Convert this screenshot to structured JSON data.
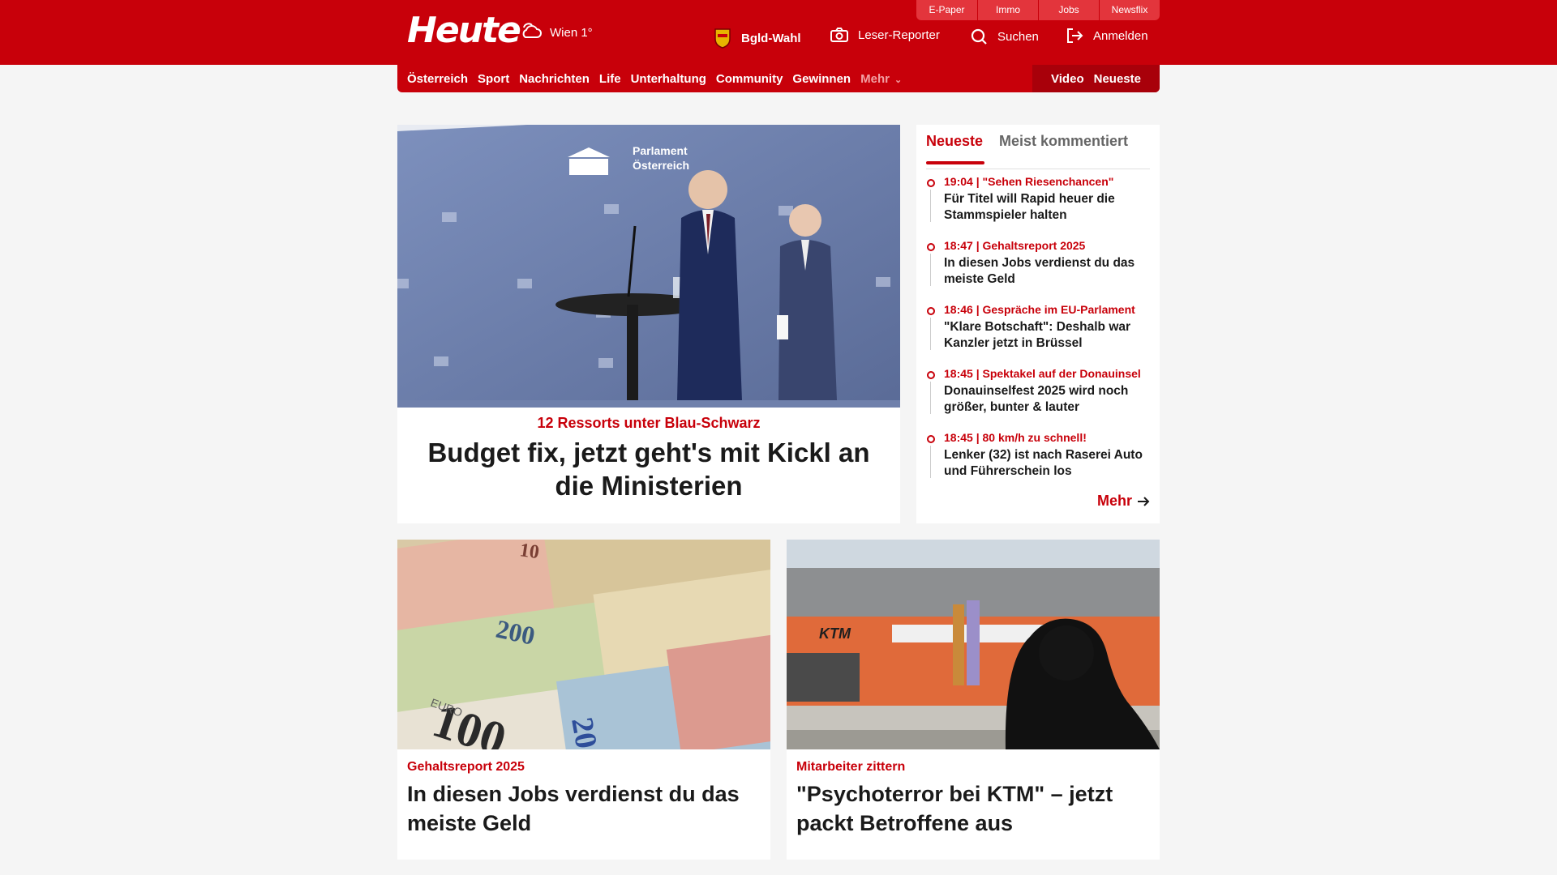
{
  "utility_links": [
    "E-Paper",
    "Immo",
    "Jobs",
    "Newsflix"
  ],
  "logo_text": "Heute",
  "weather": {
    "label": "Wien 1°",
    "icon": "cloud-sun-icon"
  },
  "header_actions": {
    "election": "Bgld-Wahl",
    "reporter": "Leser-Reporter",
    "search": "Suchen",
    "login": "Anmelden"
  },
  "nav": {
    "items": [
      "Österreich",
      "Sport",
      "Nachrichten",
      "Life",
      "Unterhaltung",
      "Community",
      "Gewinnen"
    ],
    "more": "Mehr",
    "video": "Video",
    "newest": "Neueste"
  },
  "hero": {
    "image_text": [
      "Parlament",
      "Österreich"
    ],
    "kicker": "12 Ressorts unter Blau-Schwarz",
    "title": "Budget fix, jetzt geht's mit Kickl an die Ministerien"
  },
  "sidebar": {
    "tabs": [
      "Neueste",
      "Meist kommentiert"
    ],
    "items": [
      {
        "meta": "19:04 | \"Sehen Riesenchancen\"",
        "title": "Für Titel will Rapid heuer die Stammspieler halten"
      },
      {
        "meta": "18:47 | Gehaltsreport 2025",
        "title": "In diesen Jobs verdienst du das meiste Geld"
      },
      {
        "meta": "18:46 | Gespräche im EU-Parlament",
        "title": "\"Klare Botschaft\": Deshalb war Kanzler jetzt in Brüssel"
      },
      {
        "meta": "18:45 | Spektakel auf der Donauinsel",
        "title": "Donauinselfest 2025 wird noch größer, bunter & lauter"
      },
      {
        "meta": "18:45 | 80 km/h zu schnell!",
        "title": "Lenker (32) ist nach Raserei Auto und Führerschein los"
      }
    ],
    "more": "Mehr"
  },
  "cards": [
    {
      "kicker": "Gehaltsreport 2025",
      "title": "In diesen Jobs verdienst du das meiste Geld",
      "image_text": [
        "200",
        "100",
        "20",
        "10",
        "EURO"
      ]
    },
    {
      "kicker": "Mitarbeiter zittern",
      "title": "\"Psychoterror bei KTM\" – jetzt packt Betroffene aus",
      "image_text": [
        "KTM"
      ]
    }
  ],
  "colors": {
    "brand_red": "#c8000a",
    "dark_red": "#a8000a",
    "utility_red": "#e3353c"
  }
}
